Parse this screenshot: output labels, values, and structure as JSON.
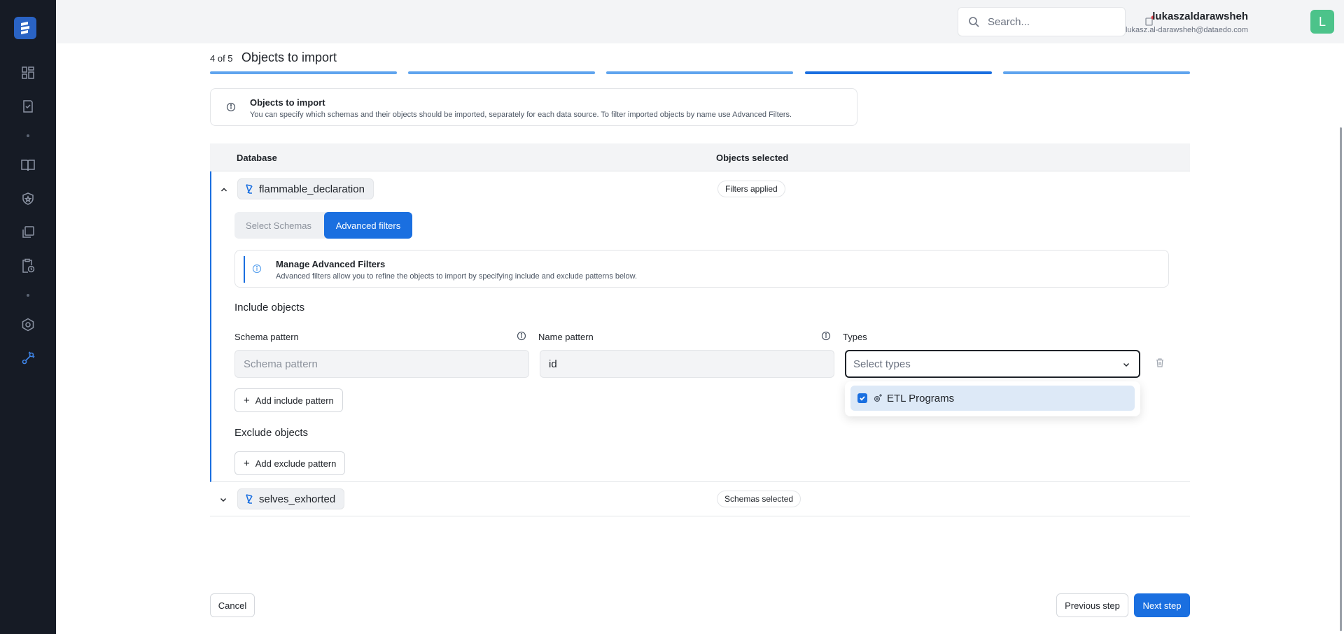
{
  "header": {
    "search_placeholder": "Search...",
    "user_name": "lukaszaldarawsheh",
    "user_email": "lukasz.al-darawsheh@dataedo.com",
    "avatar_initial": "L"
  },
  "wizard": {
    "step_counter": "4 of 5",
    "step_title": "Objects to import",
    "total_steps": 5,
    "current_step": 4
  },
  "info_box": {
    "title": "Objects to import",
    "description": "You can specify which schemas and their objects should be imported, separately for each data source. To filter imported objects by name use Advanced Filters."
  },
  "table": {
    "col_database": "Database",
    "col_objects_selected": "Objects selected",
    "rows": [
      {
        "name": "flammable_declaration",
        "status": "Filters applied",
        "expanded": true
      },
      {
        "name": "selves_exhorted",
        "status": "Schemas selected",
        "expanded": false
      }
    ]
  },
  "filters": {
    "tab_select_schemas": "Select Schemas",
    "tab_advanced": "Advanced filters",
    "manage_title": "Manage Advanced Filters",
    "manage_desc": "Advanced filters allow you to refine the objects to import by specifying include and exclude patterns below.",
    "include_title": "Include objects",
    "schema_label": "Schema pattern",
    "schema_placeholder": "Schema pattern",
    "schema_value": "",
    "name_label": "Name pattern",
    "name_value": "id",
    "types_label": "Types",
    "types_placeholder": "Select types",
    "type_options": [
      {
        "label": "ETL Programs",
        "checked": true
      }
    ],
    "add_include": "Add include pattern",
    "exclude_title": "Exclude objects",
    "add_exclude": "Add exclude pattern"
  },
  "footer": {
    "cancel": "Cancel",
    "previous": "Previous step",
    "next": "Next step"
  },
  "colors": {
    "accent": "#1a6fe0",
    "progress_done": "#5fa4ee",
    "sidebar_bg": "#161b25",
    "avatar_bg": "#4cc38a"
  }
}
